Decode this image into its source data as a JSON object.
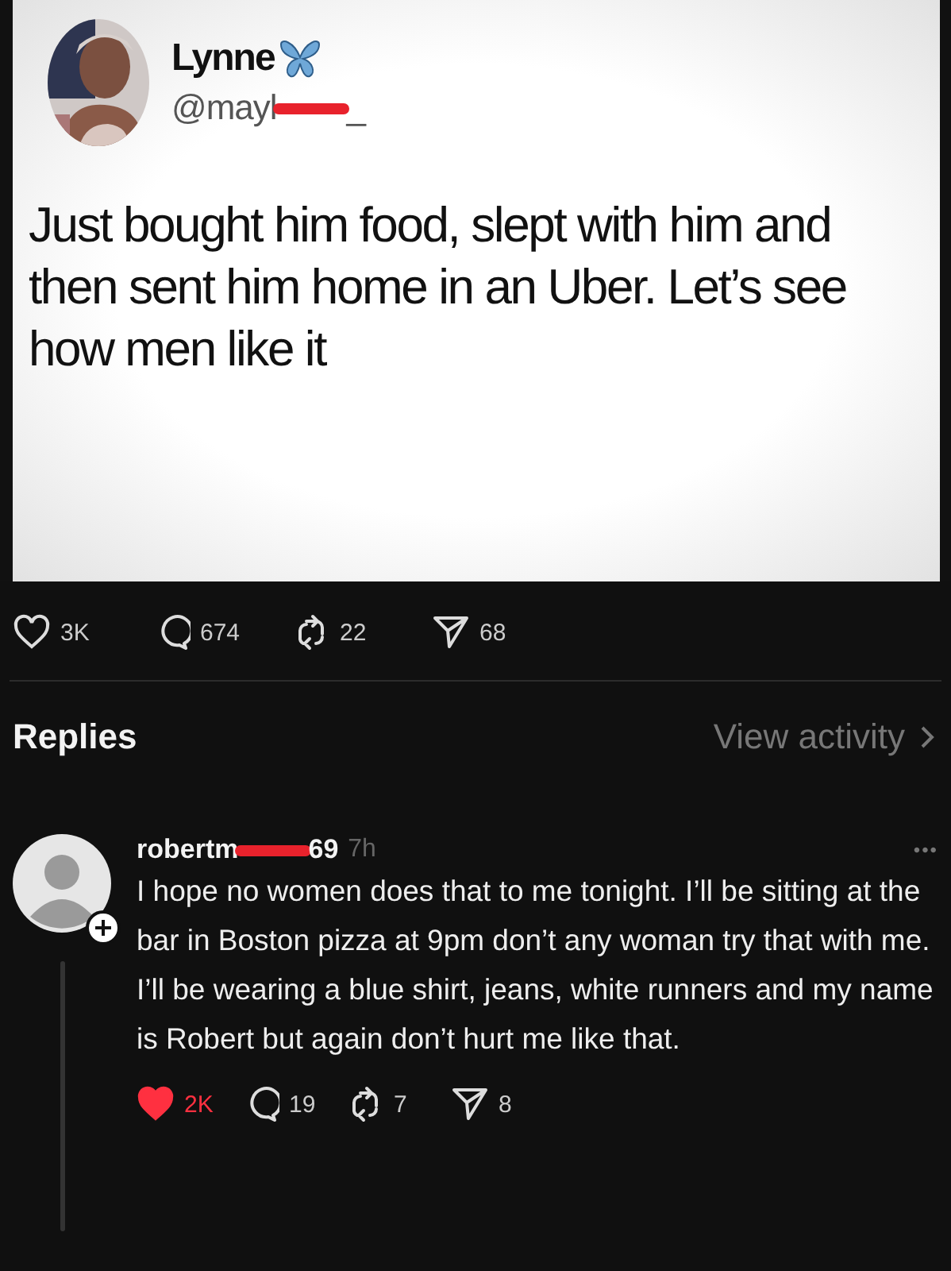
{
  "post_image": {
    "author": {
      "name": "Lynne",
      "handle_start": "@mayl",
      "handle_end": "_"
    },
    "text": "Just bought him food, slept with him and then sent him home in an Uber. Let’s see how men like it"
  },
  "post_actions": {
    "liked": false,
    "likes": "3K",
    "replies": "674",
    "reposts": "22",
    "shares": "68"
  },
  "replies_header": {
    "title": "Replies",
    "link": "View activity"
  },
  "reply": {
    "user_start": "robertm",
    "user_end": "69",
    "time": "7h",
    "more": "•••",
    "text": "I hope no women does that to me tonight. I’ll be sitting at the bar in Boston pizza at 9pm don’t any woman try that with me. I’ll be wearing a blue shirt, jeans, white runners and my name is Robert but again don’t hurt me like that.",
    "actions": {
      "liked": true,
      "likes": "2K",
      "replies": "19",
      "reposts": "7",
      "shares": "8"
    }
  }
}
